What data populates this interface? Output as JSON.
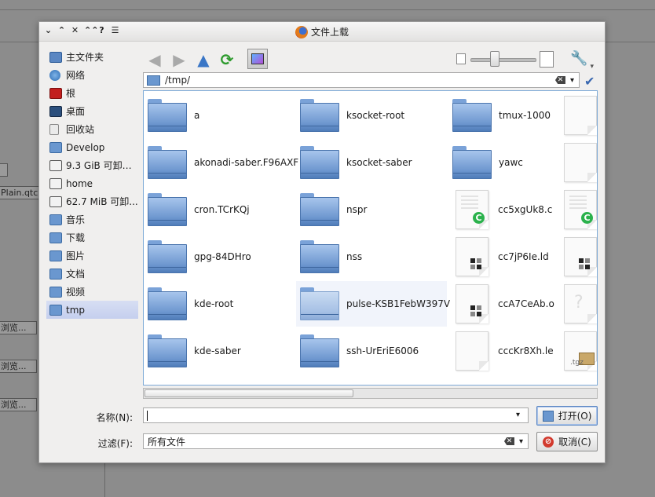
{
  "background": {
    "fragments": [
      "Plain.qtc",
      "浏览...",
      "浏览...",
      "浏览..."
    ]
  },
  "dialog": {
    "title": "文件上载",
    "titlebar_buttons": [
      "⌄",
      "⌃",
      "✕",
      "⌃⌃",
      "?",
      "☰"
    ]
  },
  "sidebar": {
    "items": [
      {
        "label": "主文件夹",
        "icon": "home-folder-icon"
      },
      {
        "label": "网络",
        "icon": "network-icon"
      },
      {
        "label": "根",
        "icon": "root-folder-icon"
      },
      {
        "label": "桌面",
        "icon": "desktop-icon"
      },
      {
        "label": "回收站",
        "icon": "trash-icon"
      },
      {
        "label": "Develop",
        "icon": "folder-icon"
      },
      {
        "label": "9.3 GiB 可卸载...",
        "icon": "drive-icon"
      },
      {
        "label": "home",
        "icon": "drive-icon"
      },
      {
        "label": "62.7 MiB 可卸...",
        "icon": "drive-icon"
      },
      {
        "label": "音乐",
        "icon": "music-folder-icon"
      },
      {
        "label": "下载",
        "icon": "download-folder-icon"
      },
      {
        "label": "图片",
        "icon": "pictures-folder-icon"
      },
      {
        "label": "文档",
        "icon": "documents-folder-icon"
      },
      {
        "label": "视频",
        "icon": "videos-folder-icon"
      },
      {
        "label": "tmp",
        "icon": "folder-icon",
        "selected": true
      }
    ]
  },
  "toolbar": {
    "back": "◀",
    "forward": "▶",
    "up": "▲",
    "reload": "⟳",
    "tools": "🔧",
    "tools_caret": "▾"
  },
  "path": {
    "value": "/tmp/",
    "clear": "✕",
    "dropdown": "▾",
    "go": "✔"
  },
  "files": {
    "columns": [
      [
        {
          "name": "a",
          "type": "folder"
        },
        {
          "name": "akonadi-saber.F96AXF",
          "type": "folder"
        },
        {
          "name": "cron.TCrKQj",
          "type": "folder"
        },
        {
          "name": "gpg-84DHro",
          "type": "folder"
        },
        {
          "name": "kde-root",
          "type": "folder"
        },
        {
          "name": "kde-saber",
          "type": "folder"
        }
      ],
      [
        {
          "name": "ksocket-root",
          "type": "folder"
        },
        {
          "name": "ksocket-saber",
          "type": "folder"
        },
        {
          "name": "nspr",
          "type": "folder"
        },
        {
          "name": "nss",
          "type": "folder"
        },
        {
          "name": "pulse-KSB1FebW397V",
          "type": "folder-light",
          "hover": true
        },
        {
          "name": "ssh-UrEriE6006",
          "type": "folder"
        }
      ],
      [
        {
          "name": "tmux-1000",
          "type": "folder"
        },
        {
          "name": "yawc",
          "type": "folder"
        },
        {
          "name": "cc5xgUk8.c",
          "type": "c-source"
        },
        {
          "name": "cc7jP6Ie.ld",
          "type": "object"
        },
        {
          "name": "ccA7CeAb.o",
          "type": "object"
        },
        {
          "name": "cccKr8Xh.le",
          "type": "blank"
        }
      ],
      [
        {
          "name": "",
          "type": "blank"
        },
        {
          "name": "",
          "type": "blank"
        },
        {
          "name": "",
          "type": "c-source"
        },
        {
          "name": "",
          "type": "object"
        },
        {
          "name": "",
          "type": "unknown"
        },
        {
          "name": "",
          "type": "tgz",
          "ext": ".tgz"
        }
      ]
    ]
  },
  "bottom": {
    "name_label": "名称(N):",
    "name_value": "",
    "filter_label": "过滤(F):",
    "filter_value": "所有文件",
    "open_button": "打开(O)",
    "cancel_button": "取消(C)"
  }
}
